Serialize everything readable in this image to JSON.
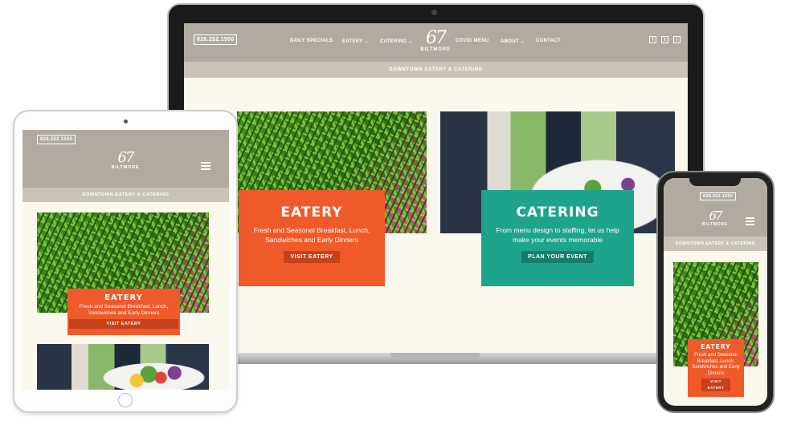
{
  "laptop": {
    "phone": "828.252.1500",
    "nav": [
      "DAILY SPECIALS",
      "EATERY ⌄",
      "CATERING ⌄",
      "COVID MENU",
      "ABOUT ⌄",
      "CONTACT"
    ],
    "logo_num": "67",
    "logo_txt": "BILTMORE",
    "social": [
      "f",
      "t",
      "i"
    ],
    "subtitle": "DOWNTOWN EATERY & CATERING",
    "eatery": {
      "title": "EATERY",
      "text": "Fresh and Seasonal Breakfast, Lunch, Sandwiches and Early Dinners",
      "button": "VISIT EATERY"
    },
    "catering": {
      "title": "CATERING",
      "text": "From menu design to staffing, let us help make your events memorable",
      "button": "PLAN YOUR EVENT"
    }
  },
  "tablet": {
    "phone": "828.252.1500",
    "logo_num": "67",
    "logo_txt": "BILTMORE",
    "subtitle": "DOWNTOWN EATERY & CATERING",
    "eatery": {
      "title": "EATERY",
      "text": "Fresh and Seasonal Breakfast, Lunch, Sandwiches and Early Dinners",
      "button": "VISIT EATERY"
    }
  },
  "phone": {
    "phone": "828.252.1500",
    "logo_num": "67",
    "logo_txt": "BILTMORE",
    "subtitle": "DOWNTOWN EATERY & CATERING",
    "eatery": {
      "title": "EATERY",
      "text": "Fresh and Seasonal Breakfast, Lunch, Sandwiches and Early Dinners",
      "button": "VISIT EATERY"
    }
  },
  "colors": {
    "nav": "#b0aaa0",
    "accent_orange": "#f05a2a",
    "accent_teal": "#1ea48b",
    "background": "#fbf8ee"
  },
  "icons": [
    "facebook-icon",
    "twitter-icon",
    "instagram-icon",
    "hamburger-menu-icon"
  ]
}
